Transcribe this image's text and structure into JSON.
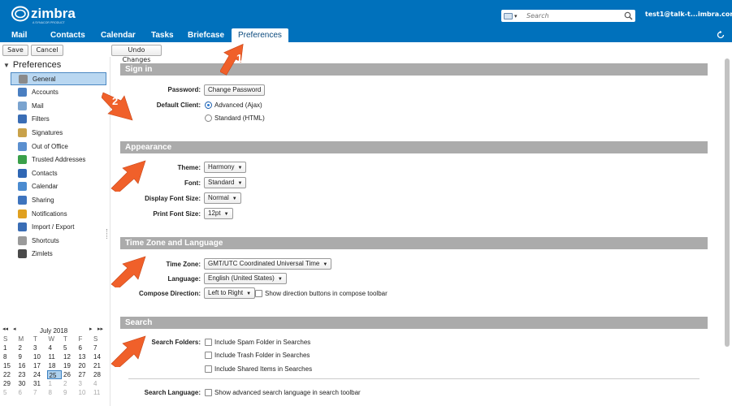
{
  "header": {
    "logo_text": "zimbra",
    "logo_sub": "A SYNACOR PRODUCT",
    "search_placeholder": "Search",
    "user": "test1@talk-t...imbra.com"
  },
  "tabs": [
    "Mail",
    "Contacts",
    "Calendar",
    "Tasks",
    "Briefcase",
    "Preferences"
  ],
  "toolbar": {
    "save": "Save",
    "cancel": "Cancel",
    "undo": "Undo Changes"
  },
  "sidebar": {
    "header": "Preferences",
    "items": [
      {
        "label": "General",
        "icon": "gear-icon",
        "color": "#8a8a8a"
      },
      {
        "label": "Accounts",
        "icon": "accounts-icon",
        "color": "#4a7fc1"
      },
      {
        "label": "Mail",
        "icon": "mail-icon",
        "color": "#7aa3cf"
      },
      {
        "label": "Filters",
        "icon": "filters-icon",
        "color": "#3a6db5"
      },
      {
        "label": "Signatures",
        "icon": "signature-icon",
        "color": "#c9a24a"
      },
      {
        "label": "Out of Office",
        "icon": "out-of-office-icon",
        "color": "#5b8fcf"
      },
      {
        "label": "Trusted Addresses",
        "icon": "shield-icon",
        "color": "#3aa04a"
      },
      {
        "label": "Contacts",
        "icon": "contacts-icon",
        "color": "#2f67b4"
      },
      {
        "label": "Calendar",
        "icon": "calendar-icon",
        "color": "#4b8bd0"
      },
      {
        "label": "Sharing",
        "icon": "sharing-icon",
        "color": "#3e74be"
      },
      {
        "label": "Notifications",
        "icon": "bell-icon",
        "color": "#e0a020"
      },
      {
        "label": "Import / Export",
        "icon": "import-export-icon",
        "color": "#3a6db5"
      },
      {
        "label": "Shortcuts",
        "icon": "shortcuts-icon",
        "color": "#9a9a9a"
      },
      {
        "label": "Zimlets",
        "icon": "zimlets-icon",
        "color": "#4a4a4a"
      }
    ]
  },
  "calendar": {
    "title": "July 2018",
    "prev_year": "◂◂",
    "prev_month": "◂",
    "next_month": "▸",
    "next_year": "▸▸",
    "weekdays": [
      "S",
      "M",
      "T",
      "W",
      "T",
      "F",
      "S"
    ],
    "weeks": [
      [
        "1",
        "2",
        "3",
        "4",
        "5",
        "6",
        "7"
      ],
      [
        "8",
        "9",
        "10",
        "11",
        "12",
        "13",
        "14"
      ],
      [
        "15",
        "16",
        "17",
        "18",
        "19",
        "20",
        "21"
      ],
      [
        "22",
        "23",
        "24",
        "25",
        "26",
        "27",
        "28"
      ],
      [
        "29",
        "30",
        "31",
        "1",
        "2",
        "3",
        "4"
      ],
      [
        "5",
        "6",
        "7",
        "8",
        "9",
        "10",
        "11"
      ]
    ],
    "today": "25"
  },
  "signin": {
    "title": "Sign in",
    "password_label": "Password:",
    "password_button": "Change Password",
    "client_label": "Default Client:",
    "client_options": [
      "Advanced (Ajax)",
      "Standard (HTML)"
    ],
    "client_selected": "Advanced (Ajax)"
  },
  "appearance": {
    "title": "Appearance",
    "theme_label": "Theme:",
    "theme_value": "Harmony",
    "font_label": "Font:",
    "font_value": "Standard",
    "display_font_label": "Display Font Size:",
    "display_font_value": "Normal",
    "print_font_label": "Print Font Size:",
    "print_font_value": "12pt"
  },
  "timezone": {
    "title": "Time Zone and Language",
    "tz_label": "Time Zone:",
    "tz_value": "GMT/UTC Coordinated Universal Time",
    "lang_label": "Language:",
    "lang_value": "English (United States)",
    "compose_label": "Compose Direction:",
    "compose_value": "Left to Right",
    "compose_checkbox": "Show direction buttons in compose toolbar"
  },
  "search": {
    "title": "Search",
    "folders_label": "Search Folders:",
    "folder_options": [
      "Include Spam Folder in Searches",
      "Include Trash Folder in Searches",
      "Include Shared Items in Searches"
    ],
    "language_label": "Search Language:",
    "language_option": "Show advanced search language in search toolbar"
  },
  "annotations": {
    "arrow1": "1",
    "arrow2": "2",
    "color": "#f0602a"
  }
}
